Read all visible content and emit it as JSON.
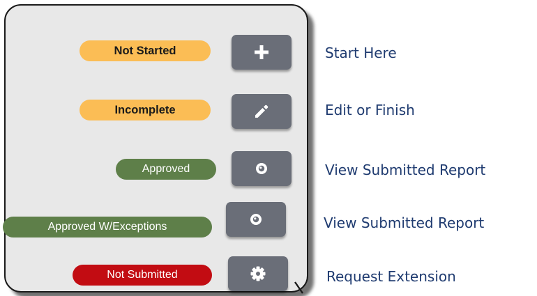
{
  "rows": [
    {
      "status": "Not Started",
      "status_color": "#fbbd55",
      "action_icon": "plus-icon",
      "caption": "Start Here"
    },
    {
      "status": "Incomplete",
      "status_color": "#fbbd55",
      "action_icon": "pencil-icon",
      "caption": "Edit or Finish"
    },
    {
      "status": "Approved",
      "status_color": "#5e7f49",
      "action_icon": "eye-icon",
      "caption": "View Submitted Report"
    },
    {
      "status": "Approved W/Exceptions",
      "status_color": "#5e7f49",
      "action_icon": "eye-icon",
      "caption": "View Submitted Report"
    },
    {
      "status": "Not Submitted",
      "status_color": "#c20c12",
      "action_icon": "gear-icon",
      "caption": "Request Extension"
    }
  ],
  "colors": {
    "button": "#6a6e78",
    "caption_text": "#1f3b70",
    "panel_bg": "#e8e8e8"
  }
}
